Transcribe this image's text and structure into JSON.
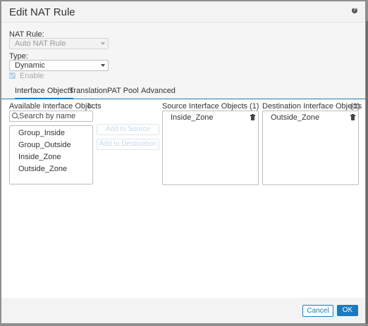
{
  "dialog": {
    "title": "Edit NAT Rule",
    "help_icon": "help-icon",
    "nat_rule": {
      "label": "NAT Rule:",
      "value": "Auto NAT Rule"
    },
    "type": {
      "label": "Type:",
      "value": "Dynamic"
    },
    "enable": {
      "label": "Enable",
      "checked": true
    },
    "tabs": [
      {
        "label": "Interface Objects",
        "active": true
      },
      {
        "label": "Translation",
        "active": false
      },
      {
        "label": "PAT Pool",
        "active": false
      },
      {
        "label": "Advanced",
        "active": false
      }
    ],
    "available": {
      "title": "Available Interface Objects",
      "refresh_icon": "refresh-icon",
      "search_placeholder": "Search by name",
      "items": [
        "Group_Inside",
        "Group_Outside",
        "Inside_Zone",
        "Outside_Zone"
      ]
    },
    "actions": {
      "add_source": "Add to Source",
      "add_destination": "Add to Destination"
    },
    "source": {
      "title": "Source Interface Objects",
      "count": "(1)",
      "items": [
        "Inside_Zone"
      ]
    },
    "destination": {
      "title": "Destination Interface Objects",
      "count": "(1)",
      "items": [
        "Outside_Zone"
      ]
    },
    "footer": {
      "cancel": "Cancel",
      "ok": "OK"
    }
  },
  "colors": {
    "accent": "#1a7bc0",
    "disabled_text": "#c4d9ea"
  }
}
